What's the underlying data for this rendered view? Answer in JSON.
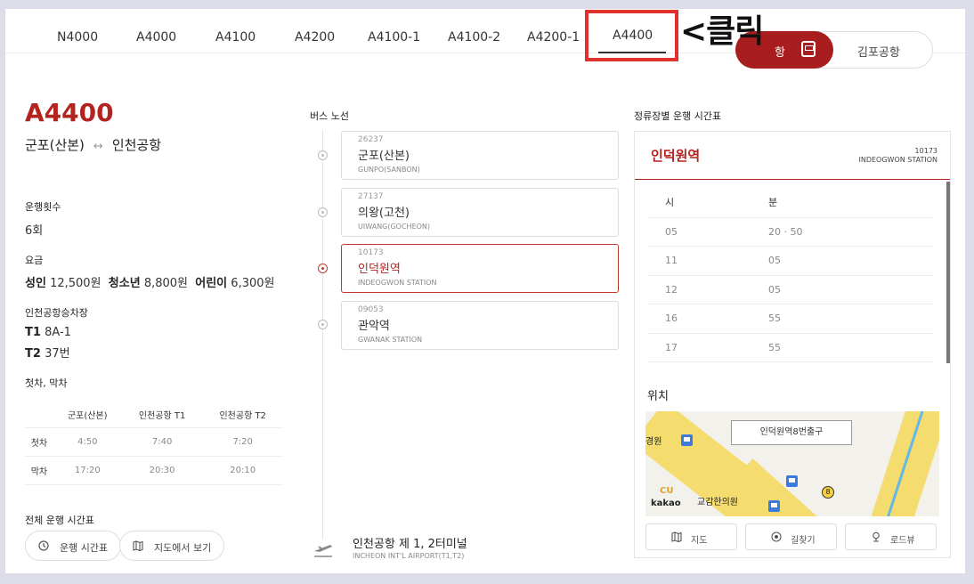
{
  "tabs": [
    {
      "label": "N4000"
    },
    {
      "label": "A4000"
    },
    {
      "label": "A4100"
    },
    {
      "label": "A4200"
    },
    {
      "label": "A4100-1"
    },
    {
      "label": "A4100-2"
    },
    {
      "label": "A4200-1"
    },
    {
      "label": "A4400"
    }
  ],
  "annotation": {
    "click_note": "<클릭"
  },
  "airport_toggle": {
    "active_label": "항",
    "other_label": "김포공항"
  },
  "route": {
    "code": "A4400",
    "from": "군포(산본)",
    "arrow": "↔",
    "to": "인천공항"
  },
  "info": {
    "runs_label": "운행횟수",
    "runs_value": "6회",
    "fare_label": "요금",
    "fare_adult_label": "성인",
    "fare_adult": "12,500원",
    "fare_youth_label": "청소년",
    "fare_youth": "8,800원",
    "fare_child_label": "어린이",
    "fare_child": "6,300원",
    "boarding_label": "인천공항승차장",
    "t1_label": "T1",
    "t1_value": "8A-1",
    "t2_label": "T2",
    "t2_value": "37번",
    "first_last_label": "첫차, 막차"
  },
  "first_last_table": {
    "headers": [
      "",
      "군포(산본)",
      "인천공항 T1",
      "인천공항 T2"
    ],
    "rows": [
      {
        "label": "첫차",
        "values": [
          "4:50",
          "7:40",
          "7:20"
        ]
      },
      {
        "label": "막차",
        "values": [
          "17:20",
          "20:30",
          "20:10"
        ]
      }
    ]
  },
  "full_schedule": {
    "label": "전체 운행 시간표",
    "timetable_button": "운행 시간표",
    "map_button": "지도에서 보기"
  },
  "bus_route": {
    "title": "버스 노선",
    "stops": [
      {
        "id": "26237",
        "name": "군포(산본)",
        "en": "GUNPO(SANBON)"
      },
      {
        "id": "27137",
        "name": "의왕(고천)",
        "en": "UIWANG(GOCHEON)"
      },
      {
        "id": "10173",
        "name": "인덕원역",
        "en": "INDEOGWON STATION"
      },
      {
        "id": "09053",
        "name": "관악역",
        "en": "GWANAK STATION"
      }
    ],
    "terminal_name": "인천공항 제 1, 2터미널",
    "terminal_en": "INCHEON INT'L AIRPORT(T1,T2)"
  },
  "stop_timetable": {
    "title": "정류장별 운행 시간표",
    "stop_name": "인덕원역",
    "stop_id": "10173",
    "stop_en": "INDEOGWON STATION",
    "hour_header": "시",
    "minute_header": "분",
    "rows": [
      {
        "hour": "05",
        "minutes": "20 · 50"
      },
      {
        "hour": "11",
        "minutes": "05"
      },
      {
        "hour": "12",
        "minutes": "05"
      },
      {
        "hour": "16",
        "minutes": "55"
      },
      {
        "hour": "17",
        "minutes": "55"
      }
    ]
  },
  "location": {
    "title": "위치",
    "map_label": "인덕원역8번출구",
    "map_texts": [
      "경원",
      "교감한의원",
      "kakao",
      "CU"
    ],
    "map_route_num": "8",
    "buttons": {
      "map": "지도",
      "directions": "길찾기",
      "roadview": "로드뷰"
    }
  },
  "colors": {
    "accent": "#b3231f",
    "highlight": "#e0322d"
  }
}
